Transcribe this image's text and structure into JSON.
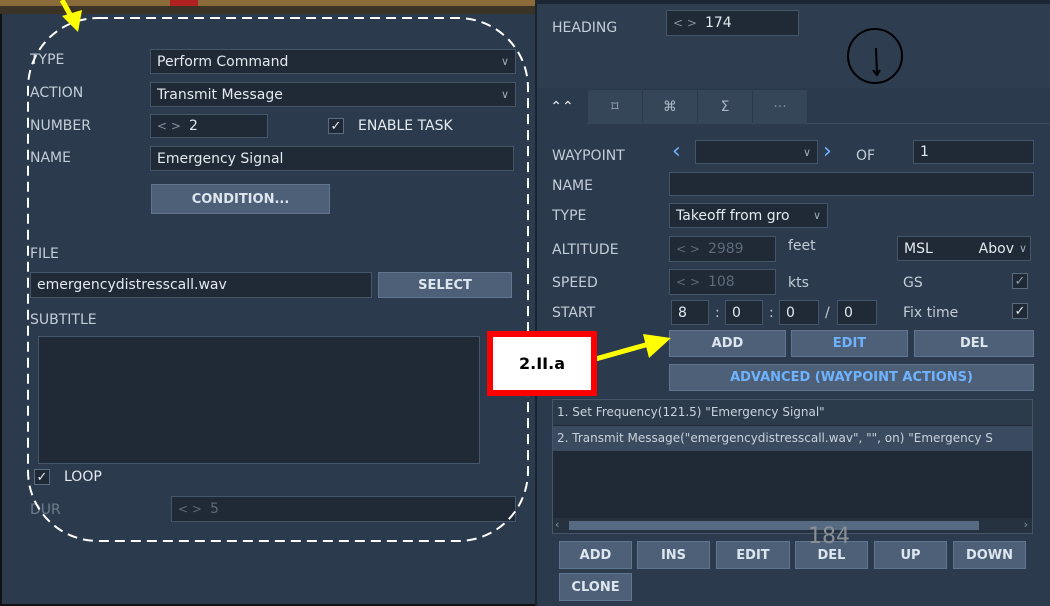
{
  "left": {
    "type_label": "TYPE",
    "type_value": "Perform Command",
    "action_label": "ACTION",
    "action_value": "Transmit Message",
    "number_label": "NUMBER",
    "number_arrows": "< >",
    "number_value": "2",
    "enable_task_label": "ENABLE TASK",
    "enable_task_checked": "✓",
    "name_label": "NAME",
    "name_value": "Emergency Signal",
    "condition_button": "CONDITION...",
    "file_label": "FILE",
    "file_value": "emergencydistresscall.wav",
    "select_button": "SELECT",
    "subtitle_label": "SUBTITLE",
    "loop_label": "LOOP",
    "loop_checked": "✓",
    "dur_label": "DUR",
    "dur_arrows": "< >",
    "dur_value": "5"
  },
  "right": {
    "heading_label": "HEADING",
    "heading_arrows": "< >",
    "heading_value": "174",
    "tabs": [
      "⌃⌃",
      "⌑",
      "⌘",
      "Σ",
      "···"
    ],
    "waypoint_label": "WAYPOINT",
    "of_label": "OF",
    "of_value": "1",
    "name_label": "NAME",
    "type_label": "TYPE",
    "type_value": "Takeoff from gro",
    "altitude_label": "ALTITUDE",
    "altitude_arrows": "< >",
    "altitude_value": "2989",
    "altitude_unit": "feet",
    "altitude_ref": "MSL",
    "altitude_ref2": "Abov",
    "speed_label": "SPEED",
    "speed_arrows": "< >",
    "speed_value": "108",
    "speed_unit": "kts",
    "gs_label": "GS",
    "gs_checked": "✓",
    "start_label": "START",
    "start_h": "8",
    "start_m": "0",
    "start_s": "0",
    "start_d": "0",
    "sep1": ":",
    "sep2": ":",
    "sep3": "/",
    "fixtime_label": "Fix time",
    "fixtime_checked": "✓",
    "add_button": "ADD",
    "edit_button": "EDIT",
    "del_button": "DEL",
    "advanced_button": "ADVANCED (WAYPOINT ACTIONS)",
    "actions": [
      "1. Set Frequency(121.5) \"Emergency Signal\"",
      "2. Transmit Message(\"emergencydistresscall.wav\", \"\", on) \"Emergency S"
    ],
    "bottom_buttons": {
      "add": "ADD",
      "ins": "INS",
      "edit": "EDIT",
      "del": "DEL",
      "up": "UP",
      "down": "DOWN",
      "clone": "CLONE"
    },
    "page_number": "184"
  },
  "annotation": {
    "callout": "2.II.a"
  },
  "colors": {
    "panel": "#2b3a4c",
    "field": "#1f2a36",
    "button": "#4d6078",
    "accent_blue": "#6fb3ff",
    "annotation_yellow": "#ffff00",
    "callout_red": "#ff0000"
  }
}
